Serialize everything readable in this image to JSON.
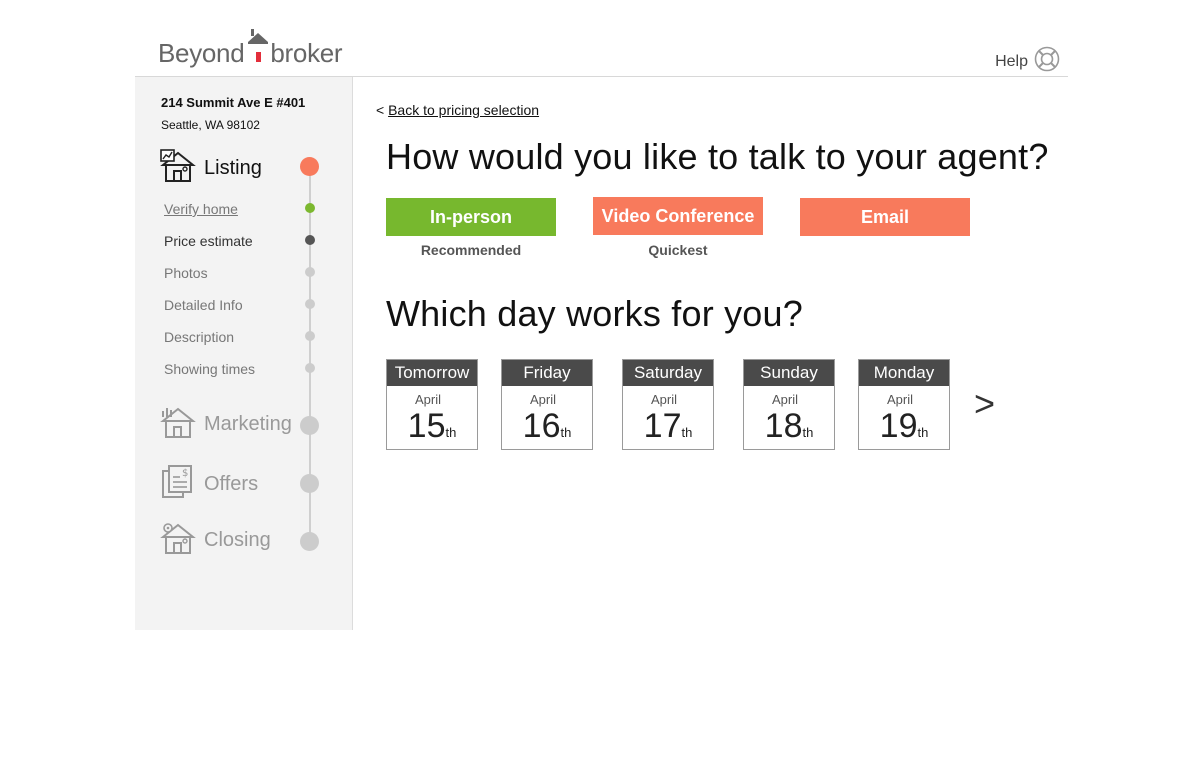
{
  "brand": {
    "part1": "Beyond",
    "part2": "broker"
  },
  "header": {
    "help_label": "Help"
  },
  "property": {
    "address_line1": "214 Summit Ave E #401",
    "address_line2": "Seattle, WA 98102"
  },
  "sidebar": {
    "sections": [
      {
        "label": "Listing",
        "icon": "house-chart-icon",
        "state": "active",
        "dot_color": "#f87a5c"
      },
      {
        "label": "Marketing",
        "icon": "house-bars-icon",
        "state": "inactive",
        "dot_color": "#cccccc"
      },
      {
        "label": "Offers",
        "icon": "documents-dollar-icon",
        "state": "inactive",
        "dot_color": "#cccccc"
      },
      {
        "label": "Closing",
        "icon": "house-gear-icon",
        "state": "inactive",
        "dot_color": "#cccccc"
      }
    ],
    "steps": [
      {
        "label": "Verify home",
        "state": "done",
        "dot_color": "#7cb82f"
      },
      {
        "label": "Price estimate",
        "state": "current",
        "dot_color": "#555555"
      },
      {
        "label": "Photos",
        "state": "pending",
        "dot_color": "#cccccc"
      },
      {
        "label": "Detailed Info",
        "state": "pending",
        "dot_color": "#cccccc"
      },
      {
        "label": "Description",
        "state": "pending",
        "dot_color": "#cccccc"
      },
      {
        "label": "Showing times",
        "state": "pending",
        "dot_color": "#cccccc"
      }
    ]
  },
  "main": {
    "back_prefix": "< ",
    "back_link": "Back to pricing selection",
    "question_contact": "How would you like to talk to your agent?",
    "contact_options": [
      {
        "label": "In-person",
        "sublabel": "Recommended",
        "color": "#77b82e"
      },
      {
        "label": "Video Conference",
        "sublabel": "Quickest",
        "color": "#f87a5c"
      },
      {
        "label": "Email",
        "sublabel": "",
        "color": "#f87a5c"
      }
    ],
    "question_day": "Which day works for you?",
    "days": [
      {
        "weekday": "Tomorrow",
        "month": "April",
        "day": "15",
        "suffix": "th"
      },
      {
        "weekday": "Friday",
        "month": "April",
        "day": "16",
        "suffix": "th"
      },
      {
        "weekday": "Saturday",
        "month": "April",
        "day": "17",
        "suffix": "th"
      },
      {
        "weekday": "Sunday",
        "month": "April",
        "day": "18",
        "suffix": "th"
      },
      {
        "weekday": "Monday",
        "month": "April",
        "day": "19",
        "suffix": "th"
      }
    ],
    "next_label": ">"
  },
  "colors": {
    "accent_red": "#f87a5c",
    "accent_green": "#77b82e",
    "dark_header": "#4a4a4a"
  }
}
